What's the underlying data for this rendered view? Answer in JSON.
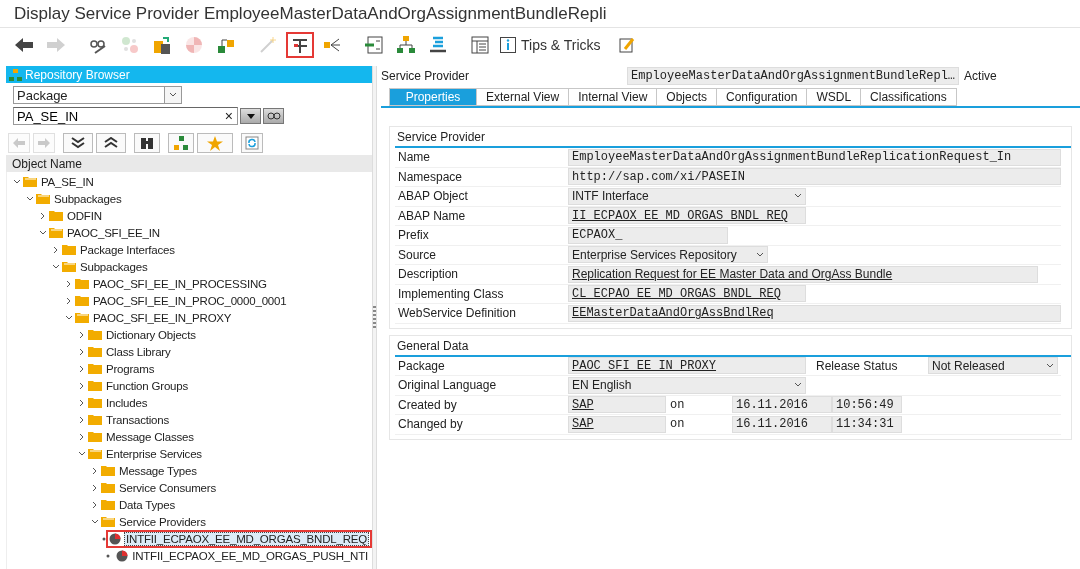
{
  "window": {
    "title": "Display Service Provider EmployeeMasterDataAndOrgAssignmentBundleRepli"
  },
  "toolbar": {
    "buttons": [
      {
        "disabled": false,
        "highlighted": false
      },
      {
        "disabled": true,
        "highlighted": false
      },
      {
        "disabled": false,
        "highlighted": false
      },
      {
        "disabled": true,
        "highlighted": false
      },
      {
        "disabled": false,
        "highlighted": false
      },
      {
        "disabled": true,
        "highlighted": false
      },
      {
        "disabled": false,
        "highlighted": false
      },
      {
        "disabled": true,
        "highlighted": false
      },
      {
        "disabled": false,
        "highlighted": true
      },
      {
        "disabled": false,
        "highlighted": false
      },
      {
        "disabled": false,
        "highlighted": false
      },
      {
        "disabled": false,
        "highlighted": false
      },
      {
        "disabled": false,
        "highlighted": false
      },
      {
        "disabled": false,
        "highlighted": false
      }
    ],
    "tips_label": "Tips & Tricks"
  },
  "repository_browser": {
    "title": "Repository Browser",
    "object_type": "Package",
    "search_value": "PA_SE_IN",
    "clear_label": "×",
    "column_header": "Object Name",
    "tree": [
      {
        "label": "PA_SE_IN",
        "kind": "folder",
        "expanded": true,
        "children": [
          {
            "label": "Subpackages",
            "kind": "folder",
            "expanded": true,
            "children": [
              {
                "label": "ODFIN",
                "kind": "folder",
                "expanded": false
              },
              {
                "label": "PAOC_SFI_EE_IN",
                "kind": "folder",
                "expanded": true,
                "children": [
                  {
                    "label": "Package Interfaces",
                    "kind": "folder",
                    "expanded": false
                  },
                  {
                    "label": "Subpackages",
                    "kind": "folder",
                    "expanded": true,
                    "children": [
                      {
                        "label": "PAOC_SFI_EE_IN_PROCESSING",
                        "kind": "folder",
                        "expanded": false
                      },
                      {
                        "label": "PAOC_SFI_EE_IN_PROC_0000_0001",
                        "kind": "folder",
                        "expanded": false
                      },
                      {
                        "label": "PAOC_SFI_EE_IN_PROXY",
                        "kind": "folder",
                        "expanded": true,
                        "children": [
                          {
                            "label": "Dictionary Objects",
                            "kind": "folder",
                            "expanded": false
                          },
                          {
                            "label": "Class Library",
                            "kind": "folder",
                            "expanded": false
                          },
                          {
                            "label": "Programs",
                            "kind": "folder",
                            "expanded": false
                          },
                          {
                            "label": "Function Groups",
                            "kind": "folder",
                            "expanded": false
                          },
                          {
                            "label": "Includes",
                            "kind": "folder",
                            "expanded": false
                          },
                          {
                            "label": "Transactions",
                            "kind": "folder",
                            "expanded": false
                          },
                          {
                            "label": "Message Classes",
                            "kind": "folder",
                            "expanded": false
                          },
                          {
                            "label": "Enterprise Services",
                            "kind": "folder",
                            "expanded": true,
                            "children": [
                              {
                                "label": "Message Types",
                                "kind": "folder",
                                "expanded": false
                              },
                              {
                                "label": "Service Consumers",
                                "kind": "folder",
                                "expanded": false
                              },
                              {
                                "label": "Data Types",
                                "kind": "folder",
                                "expanded": false
                              },
                              {
                                "label": "Service Providers",
                                "kind": "folder",
                                "expanded": true,
                                "children": [
                                  {
                                    "label": "INTFII_ECPAOX_EE_MD_ORGAS_BNDL_REQ",
                                    "kind": "service",
                                    "selected": true,
                                    "highlighted": true
                                  },
                                  {
                                    "label": "INTFII_ECPAOX_EE_MD_ORGAS_PUSH_NTI",
                                    "kind": "service",
                                    "selected": false,
                                    "highlighted": false
                                  }
                                ]
                              }
                            ]
                          }
                        ]
                      }
                    ]
                  }
                ]
              }
            ]
          }
        ]
      }
    ]
  },
  "header": {
    "label": "Service Provider",
    "name": "EmployeeMasterDataAndOrgAssignmentBundleRepl…",
    "status": "Active"
  },
  "tabs": [
    {
      "label": "Properties",
      "selected": true
    },
    {
      "label": "External View",
      "selected": false
    },
    {
      "label": "Internal View",
      "selected": false
    },
    {
      "label": "Objects",
      "selected": false
    },
    {
      "label": "Configuration",
      "selected": false
    },
    {
      "label": "WSDL",
      "selected": false
    },
    {
      "label": "Classifications",
      "selected": false
    }
  ],
  "service_provider": {
    "title": "Service Provider",
    "fields": [
      {
        "label": "Name",
        "value": "EmployeeMasterDataAndOrgAssignmentBundleReplicationRequest_In",
        "kind": "code"
      },
      {
        "label": "Namespace",
        "value": "http://sap.com/xi/PASEIN",
        "kind": "code"
      },
      {
        "label": "ABAP Object",
        "value": "INTF Interface",
        "kind": "select"
      },
      {
        "label": "ABAP Name",
        "value": "II_ECPAOX_EE_MD_ORGAS_BNDL_REQ",
        "kind": "code_link"
      },
      {
        "label": "Prefix",
        "value": "ECPAOX_",
        "kind": "code"
      },
      {
        "label": "Source",
        "value": "Enterprise Services Repository",
        "kind": "select"
      },
      {
        "label": "Description",
        "value": "Replication Request for EE Master Data and OrgAss Bundle",
        "kind": "text_link"
      },
      {
        "label": "Implementing Class",
        "value": "CL_ECPAO_EE_MD_ORGAS_BNDL_REQ",
        "kind": "code_link"
      },
      {
        "label": "WebService Definition",
        "value": "EEMasterDataAndOrgAssBndlReq",
        "kind": "code_link"
      }
    ]
  },
  "general_data": {
    "title": "General Data",
    "package": {
      "label": "Package",
      "value": "PAOC_SFI_EE_IN_PROXY"
    },
    "release_status": {
      "label": "Release Status",
      "value": "Not Released"
    },
    "original_language": {
      "label": "Original Language",
      "value": "EN English"
    },
    "created": {
      "label": "Created by",
      "user": "SAP",
      "on": "on",
      "date": "16.11.2016",
      "time": "10:56:49"
    },
    "changed": {
      "label": "Changed by",
      "user": "SAP",
      "on": "on",
      "date": "16.11.2016",
      "time": "11:34:31"
    }
  }
}
